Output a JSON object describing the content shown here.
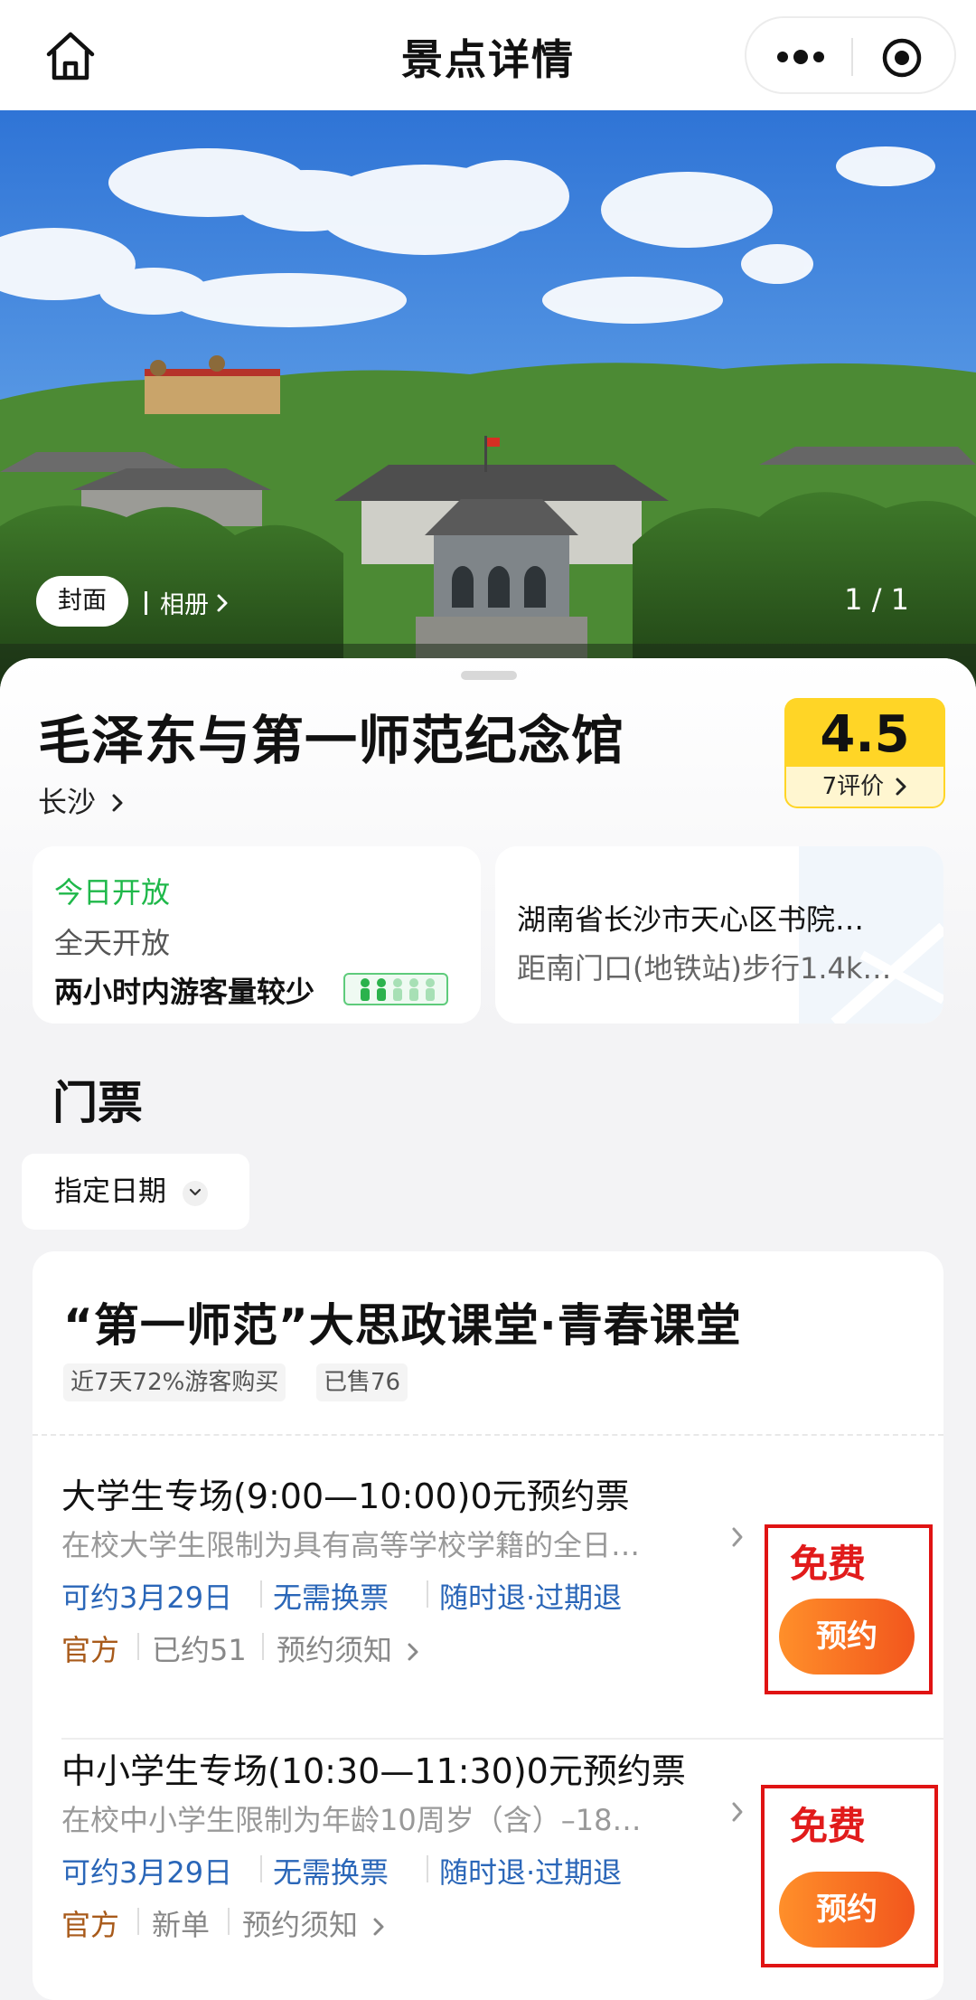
{
  "topbar": {
    "title": "景点详情"
  },
  "hero": {
    "cover_label": "封面",
    "album_label": "相册",
    "photo_count": "1 / 1"
  },
  "poi": {
    "name": "毛泽东与第一师范纪念馆",
    "city": "长沙",
    "rating": "4.5",
    "reviews": "7评价",
    "open_status": "今日开放",
    "open_hours": "全天开放",
    "crowd": "两小时内游客量较少",
    "address": "湖南省长沙市天心区书院…",
    "distance": "距南门口(地铁站)步行1.4k…"
  },
  "tickets": {
    "section_title": "门票",
    "date_filter": "指定日期",
    "product_title": "“第一师范”大思政课堂·青春课堂",
    "tags": [
      "近7天72%游客购买",
      "已售76"
    ],
    "items": [
      {
        "name": "大学生专场(9:00—10:00)0元预约票",
        "desc": "在校大学生限制为具有高等学校学籍的全日…",
        "features": [
          "可约3月29日",
          "无需换票",
          "随时退·过期退"
        ],
        "official": "官方",
        "sold": "已约51",
        "notice": "预约须知",
        "price": "免费",
        "button": "预约"
      },
      {
        "name": "中小学生专场(10:30—11:30)0元预约票",
        "desc": "在校中小学生限制为年龄10周岁（含）–18…",
        "features": [
          "可约3月29日",
          "无需换票",
          "随时退·过期退"
        ],
        "official": "官方",
        "sold": "新单",
        "notice": "预约须知",
        "price": "免费",
        "button": "预约"
      }
    ]
  },
  "colors": {
    "accent_green": "#1fb84a",
    "feature_blue": "#2a66b8",
    "rating_yellow": "#ffd526",
    "button_orange": "#f2561d",
    "highlight_red": "#e01313"
  }
}
